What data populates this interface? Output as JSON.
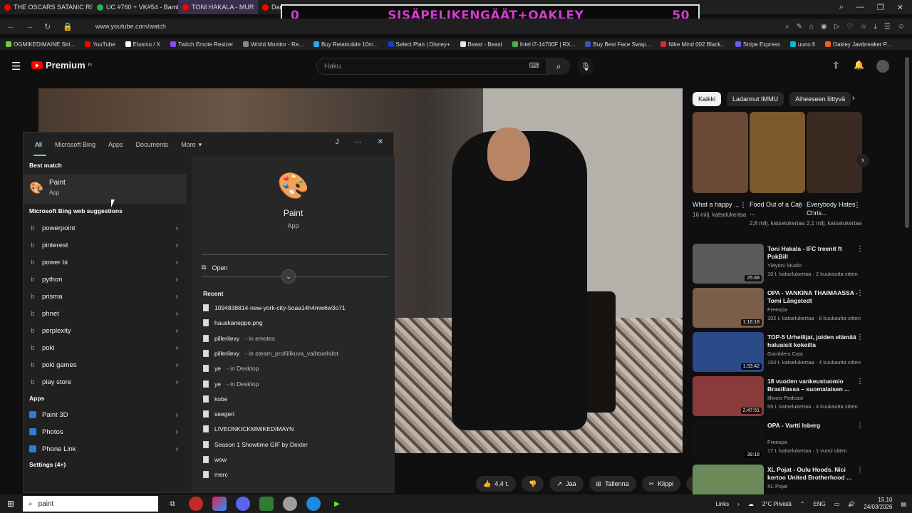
{
  "browser": {
    "tabs": [
      {
        "title": "THE OSCARS SATANIC RIT",
        "color": "#ff0000"
      },
      {
        "title": "UC #760 + VK#54 - Bamb",
        "color": "#1db954"
      },
      {
        "title": "TONI HAKALA - MUR",
        "color": "#ff0000",
        "active": true
      },
      {
        "title": "Dangers These Acts will n",
        "color": "#ff0000"
      },
      {
        "title": "IFC 7 Italeno Kunnaime",
        "color": "#ff0000"
      }
    ],
    "url": "www.youtube.com/watch",
    "bookmarks": [
      {
        "label": "OGMIKEDIMAINE Stri...",
        "color": "#7ac943"
      },
      {
        "label": "YouTube",
        "color": "#ff0000"
      },
      {
        "label": "Etusivu / X",
        "color": "#ffffff"
      },
      {
        "label": "Twitch Emote Resizer",
        "color": "#9146ff"
      },
      {
        "label": "World Monitor - Re...",
        "color": "#888888"
      },
      {
        "label": "Buy Retatrutide 10m...",
        "color": "#2ea8e0"
      },
      {
        "label": "Select Plan | Disney+",
        "color": "#113ccf"
      },
      {
        "label": "Beast - Beast",
        "color": "#e6e6e6"
      },
      {
        "label": "Intel i7-14700F | RX...",
        "color": "#4caf50"
      },
      {
        "label": "Buy Best Face Swap...",
        "color": "#3f51b5"
      },
      {
        "label": "Nike Mind 002 Black...",
        "color": "#d32f2f"
      },
      {
        "label": "Stripe Express",
        "color": "#635bff"
      },
      {
        "label": "uuno.fi",
        "color": "#00bcd4"
      },
      {
        "label": "Oakley Jawbreaker P...",
        "color": "#ff5722"
      }
    ]
  },
  "overlay": {
    "left": "0",
    "center": "SISÄPELIKENGÄÄT+OAKLEY",
    "right": "50"
  },
  "youtube": {
    "logo_label": "Premium",
    "logo_sup": "FI",
    "search_placeholder": "Haku",
    "actions": [
      {
        "label": "4,4 t.",
        "icon": "thumbs-up-icon"
      },
      {
        "label": "",
        "icon": "thumbs-down-icon"
      },
      {
        "label": "Jaa",
        "icon": "share-icon"
      },
      {
        "label": "Tallenna",
        "icon": "save-icon"
      },
      {
        "label": "Klippi",
        "icon": "clip-icon"
      },
      {
        "label": "···",
        "icon": "more-icon"
      }
    ],
    "chips": [
      {
        "label": "Kaikki",
        "active": true
      },
      {
        "label": "Ladannut IMMU"
      },
      {
        "label": "Aiheeseen liittyvä"
      }
    ],
    "shorts": [
      {
        "title": "What a happy ...",
        "views": "16 milj. katselukertaa",
        "color": "#6a4a36"
      },
      {
        "title": "Food Out of a Can ...",
        "views": "2,8 milj. katselukertaa",
        "color": "#7a5a2a"
      },
      {
        "title": "Everybody Hates Chris...",
        "views": "2,1 milj. katselukertaa",
        "color": "#3a2a22"
      }
    ],
    "recommendations": [
      {
        "title": "Toni Hakala - IFC treenit ft PokBill",
        "channel": "Yläyöni Studio",
        "meta": "10 t. katselukertaa · 2 kuukautta sitten",
        "duration": "25:48",
        "color": "#5a5a5a"
      },
      {
        "title": "OPA - VANKINA THAIMAASSA - Tomi Långstedt",
        "channel": "Freeopa",
        "meta": "102 t. katselukertaa · 8 kuukautta sitten",
        "duration": "1:16:18",
        "color": "#7a5e4a"
      },
      {
        "title": "TOP-5 Urheilijat, joiden elämää haluaisit kokeilla",
        "channel": "Gamblers Cast",
        "meta": "150 t. katselukertaa · 4 kuukautta sitten",
        "duration": "1:33:42",
        "color": "#2a4a8a"
      },
      {
        "title": "18 vuoden vankeustuomio Brasiliassa – suomalaisen ...",
        "channel": "Illinois Podcast",
        "meta": "55 t. katselukertaa · 4 kuukautta sitten",
        "duration": "2:47:51",
        "color": "#8a3a3a"
      },
      {
        "title": "OPA - Vartti Isberg",
        "channel": "Freeopa",
        "meta": "17 t. katselukertaa · 1 vuosi sitten",
        "duration": "39:18",
        "color": "#111111"
      },
      {
        "title": "XL Pojat - Oulu Hoods. Nici kertoo United Brotherhood ...",
        "channel": "XL Pojat",
        "meta": "",
        "duration": "",
        "color": "#6a8a5a"
      }
    ]
  },
  "start_search": {
    "tabs": [
      "All",
      "Microsoft Bing",
      "Apps",
      "Documents",
      "More"
    ],
    "profile_initial": "J",
    "best_match_label": "Best match",
    "best_match": {
      "name": "Paint",
      "type": "App"
    },
    "bing_label": "Microsoft Bing web suggestions",
    "bing_suggestions": [
      "powerpoint",
      "pinterest",
      "power bi",
      "python",
      "prisma",
      "phnet",
      "perplexity",
      "poki",
      "poki games",
      "play store"
    ],
    "apps_label": "Apps",
    "apps": [
      "Paint 3D",
      "Photos",
      "Phone Link"
    ],
    "settings_label": "Settings (4+)",
    "detail": {
      "name": "Paint",
      "type": "App",
      "open_label": "Open"
    },
    "recent_label": "Recent",
    "recent": [
      {
        "name": "1094838814-new-york-city-5oaa14h4mw6w3o71",
        "loc": ""
      },
      {
        "name": "hauskaneppe.png",
        "loc": ""
      },
      {
        "name": "pillerilevy",
        "loc": " - in emotes"
      },
      {
        "name": "pillerilevy",
        "loc": " - in steam_profiilikuva_vaihtoehdot"
      },
      {
        "name": "ye",
        "loc": " - in Desktop"
      },
      {
        "name": "ye",
        "loc": " - in Desktop"
      },
      {
        "name": "kobe",
        "loc": ""
      },
      {
        "name": "seegeri",
        "loc": ""
      },
      {
        "name": "LIVEONKICKMMIKEDIMAYN",
        "loc": ""
      },
      {
        "name": "Season 1 Showtime GIF by Dexter",
        "loc": ""
      },
      {
        "name": "wow",
        "loc": ""
      },
      {
        "name": "merc",
        "loc": ""
      }
    ]
  },
  "taskbar": {
    "search_value": "paint",
    "tray_links": "Links",
    "weather": "2°C  Pilvistä",
    "lang": "ENG",
    "time": "15.10",
    "date": "24/03/2026"
  }
}
